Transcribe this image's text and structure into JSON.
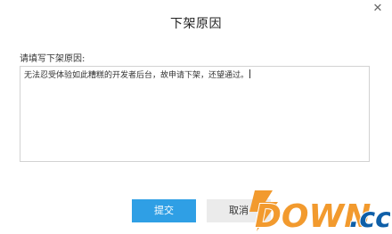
{
  "dialog": {
    "title": "下架原因",
    "close_icon": "close-icon"
  },
  "form": {
    "label": "请填写下架原因:",
    "reason_text": "无法忍受体验如此糟糕的开发者后台，故申请下架，还望通过。"
  },
  "buttons": {
    "submit_label": "提交",
    "cancel_label": "取消"
  },
  "watermark": {
    "text_main": "DOWN",
    "text_suffix": ".cc"
  },
  "colors": {
    "submit_bg": "#2f9fe5",
    "watermark_orange": "#f29a2e",
    "watermark_blue": "#0f5fa8"
  }
}
